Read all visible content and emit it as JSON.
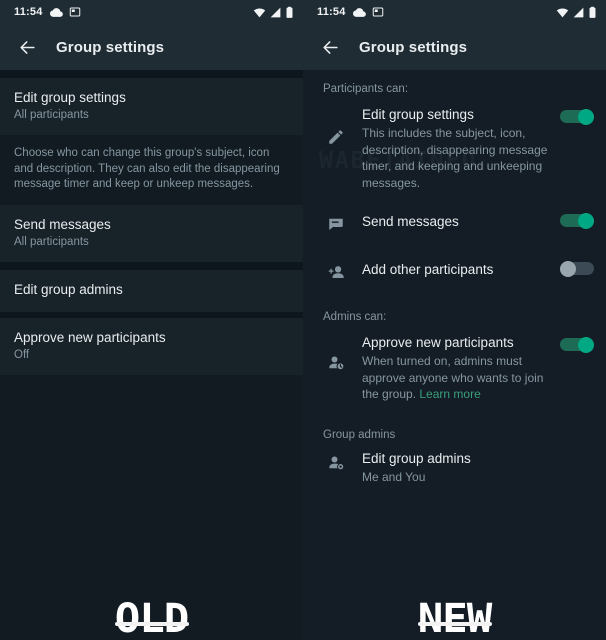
{
  "statusbar": {
    "time": "11:54",
    "icons": [
      "cloud-icon",
      "screenshot-icon",
      "wifi-icon",
      "signal-icon",
      "battery-icon"
    ]
  },
  "appbar": {
    "back_label": "back-arrow",
    "title": "Group settings"
  },
  "watermark": "WABETAINFO",
  "colors": {
    "accent_on": "#00a884",
    "accent_track": "#1d6b54",
    "toggle_off_knob": "#9aa6ad",
    "toggle_off_track": "#3b4a54",
    "link": "#3a9e7d",
    "appbar_bg": "#1f2c34",
    "body_bg": "#121b22",
    "row_bg": "#182229",
    "primary_text": "#e9edef",
    "secondary_text": "#8696a0"
  },
  "old_panel": {
    "tag": "OLD",
    "rows": [
      {
        "title": "Edit group settings",
        "subtitle": "All participants"
      },
      {
        "description": "Choose who can change this group's subject, icon and description. They can also edit the disappearing message timer and keep or unkeep messages."
      },
      {
        "title": "Send messages",
        "subtitle": "All participants"
      },
      {
        "title": "Edit group admins",
        "subtitle": ""
      },
      {
        "title": "Approve new participants",
        "subtitle": "Off"
      }
    ]
  },
  "new_panel": {
    "tag": "NEW",
    "sections": [
      {
        "label": "Participants can:",
        "items": [
          {
            "icon": "pencil-icon",
            "title": "Edit group settings",
            "subtitle": "This includes the subject, icon, description, disappearing message timer, and keeping and unkeeping messages.",
            "toggle": "on"
          },
          {
            "icon": "message-icon",
            "title": "Send messages",
            "subtitle": "",
            "toggle": "on"
          },
          {
            "icon": "person-add-icon",
            "title": "Add other participants",
            "subtitle": "",
            "toggle": "off"
          }
        ]
      },
      {
        "label": "Admins can:",
        "items": [
          {
            "icon": "person-clock-icon",
            "title": "Approve new participants",
            "subtitle": "When turned on, admins must approve anyone who wants to join the group. ",
            "link": "Learn more",
            "toggle": "on"
          }
        ]
      },
      {
        "label": "Group admins",
        "items": [
          {
            "icon": "person-gear-icon",
            "title": "Edit group admins",
            "subtitle": "Me and You",
            "toggle": null
          }
        ]
      }
    ]
  }
}
